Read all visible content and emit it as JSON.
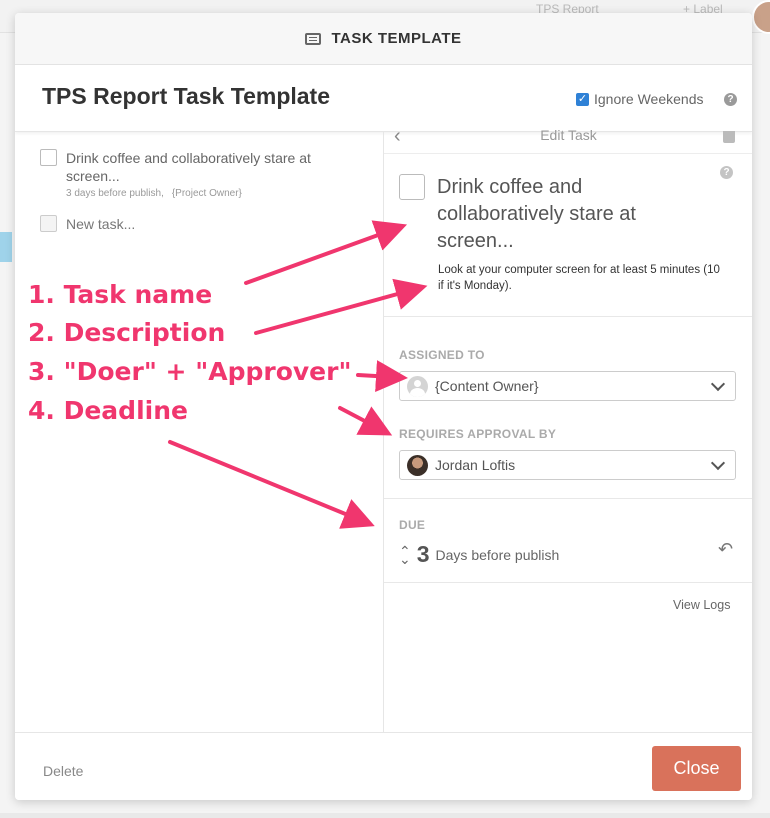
{
  "background": {
    "breadcrumb": "TPS Report",
    "label_button": "+ Label"
  },
  "modal": {
    "header_title": "TASK TEMPLATE",
    "template_name": "TPS Report Task Template",
    "ignore_weekends_label": "Ignore Weekends",
    "ignore_weekends_checked": true
  },
  "task_list": {
    "items": [
      {
        "name": "Drink coffee and collaboratively stare at screen...",
        "days": "3 days before publish,",
        "owner": "{Project Owner}"
      }
    ],
    "new_task_placeholder": "New task..."
  },
  "edit_task": {
    "header": "Edit Task",
    "name": "Drink coffee and collaboratively stare at screen...",
    "description": "Look at your computer screen for at least 5 minutes (10 if it's Monday).",
    "assigned_to_label": "ASSIGNED TO",
    "assigned_to_value": "{Content Owner}",
    "approval_label": "REQUIRES APPROVAL BY",
    "approval_value": "Jordan Loftis",
    "due_label": "DUE",
    "due_number": "3",
    "due_text": "Days before publish",
    "view_logs": "View Logs"
  },
  "footer": {
    "delete_label": "Delete",
    "close_label": "Close"
  },
  "annotations": {
    "items": [
      "1. Task name",
      "2. Description",
      "3. \"Doer\" + \"Approver\"",
      "4. Deadline"
    ],
    "color": "#f0366e"
  },
  "colors": {
    "close_button": "#d9725b",
    "checkbox_blue": "#2f81d6"
  }
}
